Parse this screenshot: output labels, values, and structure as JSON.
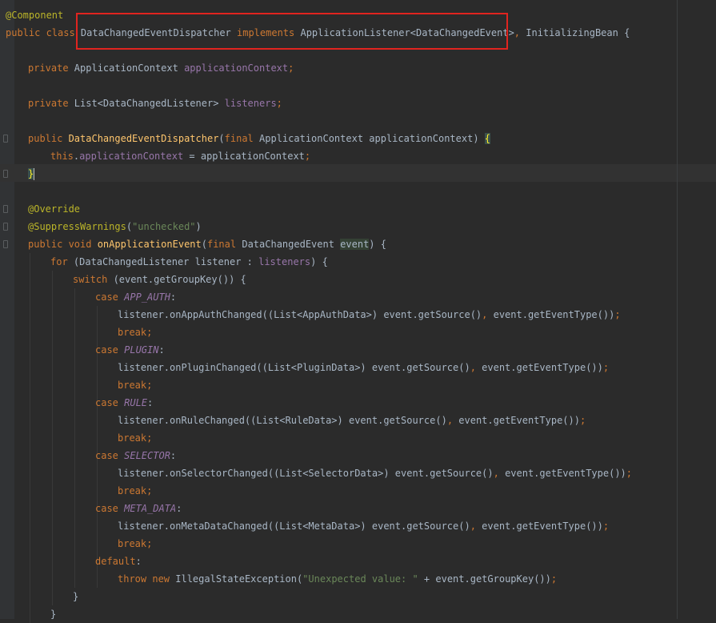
{
  "editor": {
    "language": "Java",
    "lines": [
      {
        "indent": 0,
        "tokens": [
          {
            "t": "@Component",
            "c": "ann"
          }
        ]
      },
      {
        "indent": 0,
        "tokens": [
          {
            "t": "public class ",
            "c": "k"
          },
          {
            "t": "DataChangedEventDispatcher "
          },
          {
            "t": "implements ",
            "c": "k"
          },
          {
            "t": "ApplicationListener<DataChangedEvent>"
          },
          {
            "t": ", ",
            "c": "punc"
          },
          {
            "t": "InitializingBean {"
          }
        ]
      },
      {
        "indent": 0,
        "tokens": []
      },
      {
        "indent": 1,
        "tokens": [
          {
            "t": "private ",
            "c": "k"
          },
          {
            "t": "ApplicationContext "
          },
          {
            "t": "applicationContext",
            "c": "fld"
          },
          {
            "t": ";",
            "c": "punc"
          }
        ]
      },
      {
        "indent": 0,
        "tokens": []
      },
      {
        "indent": 1,
        "tokens": [
          {
            "t": "private ",
            "c": "k"
          },
          {
            "t": "List<DataChangedListener> "
          },
          {
            "t": "listeners",
            "c": "fld"
          },
          {
            "t": ";",
            "c": "punc"
          }
        ]
      },
      {
        "indent": 0,
        "tokens": []
      },
      {
        "indent": 1,
        "tokens": [
          {
            "t": "public ",
            "c": "k"
          },
          {
            "t": "DataChangedEventDispatcher",
            "c": "mth"
          },
          {
            "t": "("
          },
          {
            "t": "final ",
            "c": "k"
          },
          {
            "t": "ApplicationContext applicationContext) "
          },
          {
            "t": "{",
            "c": "brace-hl"
          }
        ]
      },
      {
        "indent": 2,
        "tokens": [
          {
            "t": "this",
            "c": "k"
          },
          {
            "t": "."
          },
          {
            "t": "applicationContext",
            "c": "fld"
          },
          {
            "t": " = applicationContext"
          },
          {
            "t": ";",
            "c": "punc"
          }
        ]
      },
      {
        "indent": 1,
        "tokens": [
          {
            "t": "}",
            "c": "brace-hl"
          },
          {
            "t": "",
            "c": "caret"
          }
        ]
      },
      {
        "indent": 0,
        "tokens": []
      },
      {
        "indent": 1,
        "tokens": [
          {
            "t": "@Override",
            "c": "ann"
          }
        ]
      },
      {
        "indent": 1,
        "tokens": [
          {
            "t": "@SuppressWarnings",
            "c": "ann"
          },
          {
            "t": "("
          },
          {
            "t": "\"unchecked\"",
            "c": "str"
          },
          {
            "t": ")"
          }
        ]
      },
      {
        "indent": 1,
        "tokens": [
          {
            "t": "public void ",
            "c": "k"
          },
          {
            "t": "onApplicationEvent",
            "c": "mth"
          },
          {
            "t": "("
          },
          {
            "t": "final ",
            "c": "k"
          },
          {
            "t": "DataChangedEvent "
          },
          {
            "t": "event",
            "c": "hl-param"
          },
          {
            "t": ") {"
          }
        ]
      },
      {
        "indent": 2,
        "tokens": [
          {
            "t": "for ",
            "c": "k"
          },
          {
            "t": "(DataChangedListener listener : "
          },
          {
            "t": "listeners",
            "c": "fld"
          },
          {
            "t": ") {"
          }
        ]
      },
      {
        "indent": 3,
        "tokens": [
          {
            "t": "switch ",
            "c": "k"
          },
          {
            "t": "(event.getGroupKey()) {"
          }
        ]
      },
      {
        "indent": 4,
        "tokens": [
          {
            "t": "case ",
            "c": "k"
          },
          {
            "t": "APP_AUTH",
            "c": "cst"
          },
          {
            "t": ":"
          }
        ]
      },
      {
        "indent": 5,
        "tokens": [
          {
            "t": "listener.onAppAuthChanged((List<AppAuthData>) event.getSource()"
          },
          {
            "t": ", ",
            "c": "punc"
          },
          {
            "t": "event.getEventType())"
          },
          {
            "t": ";",
            "c": "punc"
          }
        ]
      },
      {
        "indent": 5,
        "tokens": [
          {
            "t": "break;",
            "c": "k"
          }
        ]
      },
      {
        "indent": 4,
        "tokens": [
          {
            "t": "case ",
            "c": "k"
          },
          {
            "t": "PLUGIN",
            "c": "cst"
          },
          {
            "t": ":"
          }
        ]
      },
      {
        "indent": 5,
        "tokens": [
          {
            "t": "listener.onPluginChanged((List<PluginData>) event.getSource()"
          },
          {
            "t": ", ",
            "c": "punc"
          },
          {
            "t": "event.getEventType())"
          },
          {
            "t": ";",
            "c": "punc"
          }
        ]
      },
      {
        "indent": 5,
        "tokens": [
          {
            "t": "break;",
            "c": "k"
          }
        ]
      },
      {
        "indent": 4,
        "tokens": [
          {
            "t": "case ",
            "c": "k"
          },
          {
            "t": "RULE",
            "c": "cst"
          },
          {
            "t": ":"
          }
        ]
      },
      {
        "indent": 5,
        "tokens": [
          {
            "t": "listener.onRuleChanged((List<RuleData>) event.getSource()"
          },
          {
            "t": ", ",
            "c": "punc"
          },
          {
            "t": "event.getEventType())"
          },
          {
            "t": ";",
            "c": "punc"
          }
        ]
      },
      {
        "indent": 5,
        "tokens": [
          {
            "t": "break;",
            "c": "k"
          }
        ]
      },
      {
        "indent": 4,
        "tokens": [
          {
            "t": "case ",
            "c": "k"
          },
          {
            "t": "SELECTOR",
            "c": "cst"
          },
          {
            "t": ":"
          }
        ]
      },
      {
        "indent": 5,
        "tokens": [
          {
            "t": "listener.onSelectorChanged((List<SelectorData>) event.getSource()"
          },
          {
            "t": ", ",
            "c": "punc"
          },
          {
            "t": "event.getEventType())"
          },
          {
            "t": ";",
            "c": "punc"
          }
        ]
      },
      {
        "indent": 5,
        "tokens": [
          {
            "t": "break;",
            "c": "k"
          }
        ]
      },
      {
        "indent": 4,
        "tokens": [
          {
            "t": "case ",
            "c": "k"
          },
          {
            "t": "META_DATA",
            "c": "cst"
          },
          {
            "t": ":"
          }
        ]
      },
      {
        "indent": 5,
        "tokens": [
          {
            "t": "listener.onMetaDataChanged((List<MetaData>) event.getSource()"
          },
          {
            "t": ", ",
            "c": "punc"
          },
          {
            "t": "event.getEventType())"
          },
          {
            "t": ";",
            "c": "punc"
          }
        ]
      },
      {
        "indent": 5,
        "tokens": [
          {
            "t": "break;",
            "c": "k"
          }
        ]
      },
      {
        "indent": 4,
        "tokens": [
          {
            "t": "default",
            "c": "k"
          },
          {
            "t": ":"
          }
        ]
      },
      {
        "indent": 5,
        "tokens": [
          {
            "t": "throw new ",
            "c": "k"
          },
          {
            "t": "IllegalStateException("
          },
          {
            "t": "\"Unexpected value: \"",
            "c": "str"
          },
          {
            "t": " + event.getGroupKey())"
          },
          {
            "t": ";",
            "c": "punc"
          }
        ]
      },
      {
        "indent": 3,
        "tokens": [
          {
            "t": "}"
          }
        ]
      },
      {
        "indent": 2,
        "tokens": [
          {
            "t": "}"
          }
        ]
      }
    ]
  }
}
